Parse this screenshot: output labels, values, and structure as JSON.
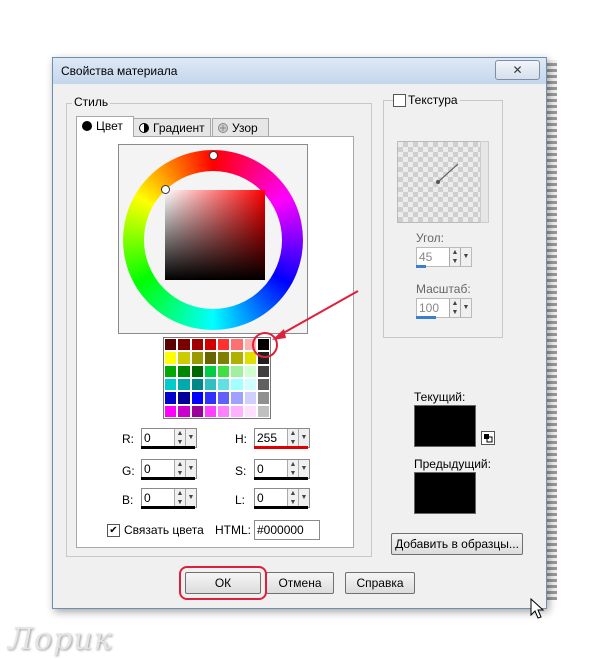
{
  "window": {
    "title": "Свойства материала",
    "close_label": "✕"
  },
  "style_group": {
    "label": "Стиль",
    "tabs": [
      {
        "label": "Цвет",
        "active": true
      },
      {
        "label": "Градиент",
        "active": false
      },
      {
        "label": "Узор",
        "active": false
      }
    ]
  },
  "palette": {
    "colors": [
      "#5a0000",
      "#7a0000",
      "#a00000",
      "#d00000",
      "#ff3030",
      "#ff7070",
      "#ffb0b0",
      "#000000",
      "#ffff00",
      "#cccc00",
      "#999900",
      "#666600",
      "#808000",
      "#b0b000",
      "#e0e000",
      "#202020",
      "#00aa00",
      "#008800",
      "#006600",
      "#00cc44",
      "#40e040",
      "#a0f0a0",
      "#d0ffd0",
      "#404040",
      "#00cccc",
      "#00aaaa",
      "#008888",
      "#30c0c0",
      "#60e0e0",
      "#a0ffff",
      "#d0ffff",
      "#606060",
      "#0000cc",
      "#000099",
      "#0000ff",
      "#3030ff",
      "#6060ff",
      "#a0a0ff",
      "#d0d0ff",
      "#909090",
      "#ff00ff",
      "#cc00cc",
      "#990099",
      "#ff40ff",
      "#ff80ff",
      "#ffb0ff",
      "#ffe0ff",
      "#c0c0c0"
    ]
  },
  "color_fields": {
    "r": {
      "label": "R:",
      "value": "0"
    },
    "g": {
      "label": "G:",
      "value": "0"
    },
    "b": {
      "label": "B:",
      "value": "0"
    },
    "h": {
      "label": "H:",
      "value": "255"
    },
    "s": {
      "label": "S:",
      "value": "0"
    },
    "l": {
      "label": "L:",
      "value": "0"
    }
  },
  "link_colors": {
    "label": "Связать цвета",
    "checked": true
  },
  "html_field": {
    "label": "HTML:",
    "value": "#000000"
  },
  "texture": {
    "label": "Текстура",
    "checked": false,
    "angle_label": "Угол:",
    "angle_value": "45",
    "scale_label": "Масштаб:",
    "scale_value": "100"
  },
  "current": {
    "label": "Текущий:",
    "color": "#000000"
  },
  "previous": {
    "label": "Предыдущий:",
    "color": "#000000"
  },
  "buttons": {
    "add_swatch": "Добавить в образцы...",
    "ok": "ОК",
    "cancel": "Отмена",
    "help": "Справка"
  },
  "annotations": {
    "highlight_color": "#e0203a"
  },
  "watermark": "Лорик"
}
